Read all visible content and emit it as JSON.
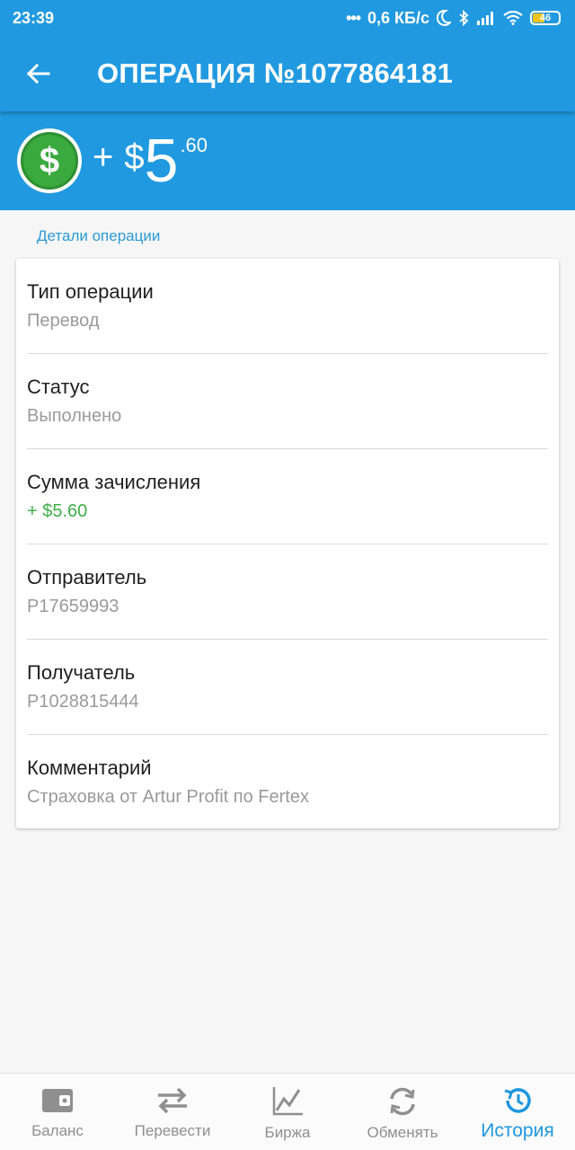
{
  "status_bar": {
    "time": "23:39",
    "network_speed": "0,6 КБ/с",
    "battery": "46"
  },
  "app_bar": {
    "title": "ОПЕРАЦИЯ №1077864181"
  },
  "amount": {
    "sign": "+",
    "currency": "$",
    "whole": "5",
    "cents": ".60"
  },
  "section_label": "Детали операции",
  "details": [
    {
      "label": "Тип операции",
      "value": "Перевод"
    },
    {
      "label": "Статус",
      "value": "Выполнено"
    },
    {
      "label": "Сумма зачисления",
      "value": "+ $5.60"
    },
    {
      "label": "Отправитель",
      "value": "P17659993"
    },
    {
      "label": "Получатель",
      "value": "P1028815444"
    },
    {
      "label": "Комментарий",
      "value": "Страховка от Artur Profit по Fertex"
    }
  ],
  "nav": [
    {
      "label": "Баланс",
      "icon": "wallet-icon"
    },
    {
      "label": "Перевести",
      "icon": "transfer-arrows-icon"
    },
    {
      "label": "Биржа",
      "icon": "chart-icon"
    },
    {
      "label": "Обменять",
      "icon": "exchange-icon"
    },
    {
      "label": "История",
      "icon": "history-icon",
      "active": true
    }
  ],
  "colors": {
    "primary": "#2199e0",
    "positive": "#3fae4a",
    "active_tab": "#1e96df"
  }
}
